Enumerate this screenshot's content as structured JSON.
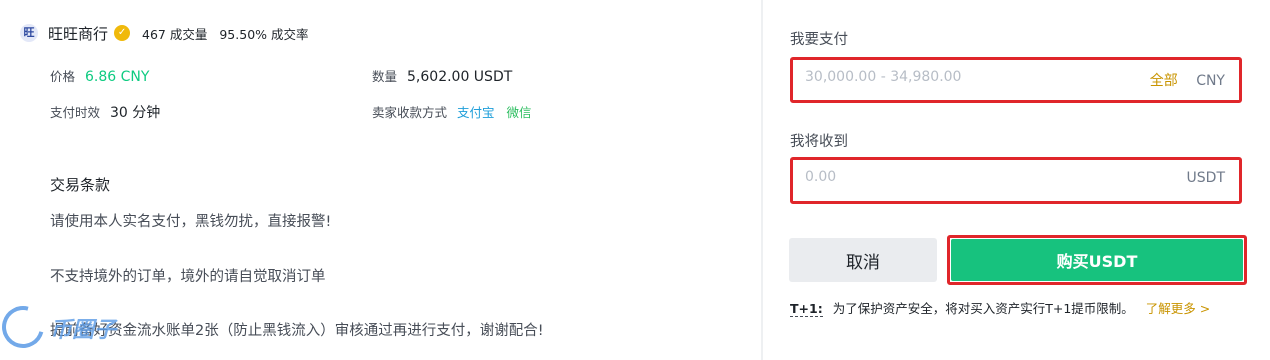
{
  "merchant": {
    "avatar_text": "旺",
    "name": "旺旺商行",
    "verified_icon": "✓",
    "orders": "467 成交量",
    "completion": "95.50% 成交率"
  },
  "details": {
    "price_label": "价格",
    "price_value": "6.86 CNY",
    "quantity_label": "数量",
    "quantity_value": "5,602.00 USDT",
    "time_label": "支付时效",
    "time_value": "30 分钟",
    "payment_label": "卖家收款方式",
    "payment_methods": [
      "支付宝",
      "微信"
    ]
  },
  "terms": {
    "title": "交易条款",
    "lines": [
      "请使用本人实名支付，黑钱勿扰，直接报警!",
      "不支持境外的订单，境外的请自觉取消订单",
      "提前备好资金流水账单2张（防止黑钱流入）审核通过再进行支付，谢谢配合!"
    ]
  },
  "watermark": {
    "text": "币圈子"
  },
  "form": {
    "pay_label": "我要支付",
    "pay_placeholder": "30,000.00 - 34,980.00",
    "pay_all": "全部",
    "pay_unit": "CNY",
    "receive_label": "我将收到",
    "receive_placeholder": "0.00",
    "receive_unit": "USDT"
  },
  "actions": {
    "cancel": "取消",
    "buy": "购买USDT"
  },
  "note": {
    "tag": "T+1:",
    "text": "为了保护资产安全，将对买入资产实行T+1提币限制。",
    "link": "了解更多 >"
  },
  "colors": {
    "accent_green": "#17c27e",
    "price_green": "#0ecb81",
    "highlight_red": "#e0262a",
    "gold": "#c99400"
  }
}
